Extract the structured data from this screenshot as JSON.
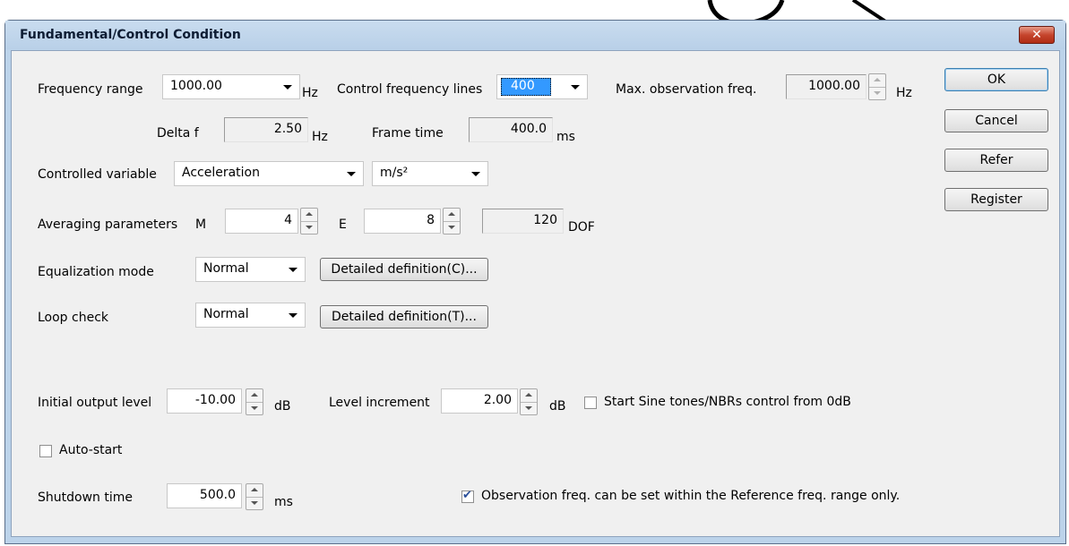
{
  "window": {
    "title": "Fundamental/Control Condition",
    "close_glyph": "✕"
  },
  "frequency": {
    "range_label": "Frequency range",
    "range_value": "1000.00",
    "range_unit": "Hz",
    "lines_label": "Control frequency lines",
    "lines_value": "400",
    "max_obs_label": "Max. observation freq.",
    "max_obs_value": "1000.00",
    "max_obs_unit": "Hz",
    "delta_label": "Delta f",
    "delta_value": "2.50",
    "delta_unit": "Hz",
    "frame_label": "Frame time",
    "frame_value": "400.0",
    "frame_unit": "ms"
  },
  "controlled": {
    "label": "Controlled variable",
    "variable": "Acceleration",
    "unit": "m/s²"
  },
  "averaging": {
    "label": "Averaging parameters",
    "m_label": "M",
    "m_value": "4",
    "e_label": "E",
    "e_value": "8",
    "dof_value": "120",
    "dof_unit": "DOF"
  },
  "equalization": {
    "label": "Equalization mode",
    "value": "Normal",
    "detail_button": "Detailed definition(C)..."
  },
  "loop": {
    "label": "Loop check",
    "value": "Normal",
    "detail_button": "Detailed definition(T)..."
  },
  "output": {
    "initial_label": "Initial output level",
    "initial_value": "-10.00",
    "initial_unit": "dB",
    "increment_label": "Level increment",
    "increment_value": "2.00",
    "increment_unit": "dB",
    "sine_label": "Start Sine tones/NBRs control from 0dB",
    "sine_checked": false
  },
  "autostart": {
    "label": "Auto-start",
    "checked": false
  },
  "shutdown": {
    "label": "Shutdown time",
    "value": "500.0",
    "unit": "ms"
  },
  "observation": {
    "label": "Observation freq. can be set within the Reference freq. range only.",
    "checked": true
  },
  "buttons": {
    "ok": "OK",
    "cancel": "Cancel",
    "refer": "Refer",
    "register": "Register"
  },
  "colors": {
    "title_bar": "#bcd3ea",
    "client_bg": "#f0f0f0",
    "selection": "#3399ff",
    "close": "#c5452d"
  }
}
